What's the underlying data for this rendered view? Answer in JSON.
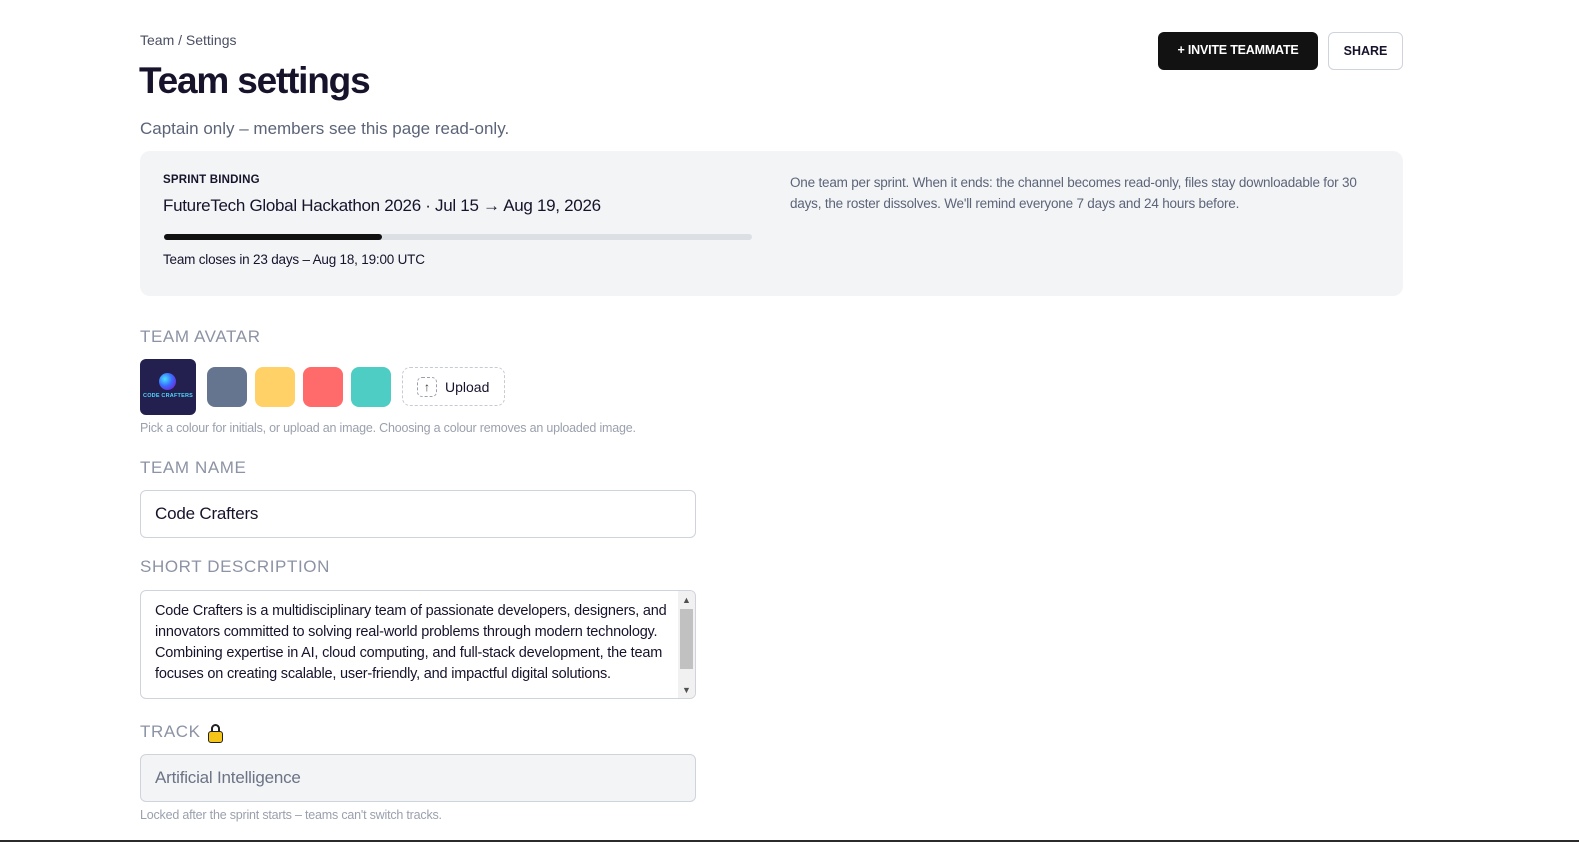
{
  "header": {
    "breadcrumb": "Team / Settings",
    "title": "Team settings",
    "subtitle": "Captain only – members see this page read-only.",
    "invite_label": "+ INVITE TEAMMATE",
    "share_label": "SHARE"
  },
  "sprint": {
    "label": "SPRINT BINDING",
    "event": "FutureTech Global Hackathon 2026 · Jul 15 → Aug 19, 2026",
    "progress_fraction": 0.37,
    "closes": "Team closes in 23 days – Aug 18, 19:00 UTC",
    "note": "One team per sprint. When it ends: the channel becomes read-only, files stay downloadable for 30 days, the roster dissolves. We'll remind everyone 7 days and 24 hours before."
  },
  "avatar": {
    "label": "TEAM AVATAR",
    "current_text": "CODE CRAFTERS",
    "swatches": [
      "#66758f",
      "#ffd166",
      "#ff6b6b",
      "#4ecdc4"
    ],
    "upload_label": "Upload",
    "upload_icon": "arrow-up-icon",
    "hint": "Pick a colour for initials, or upload an image. Choosing a colour removes an uploaded image."
  },
  "team_name": {
    "label": "TEAM NAME",
    "value": "Code Crafters"
  },
  "description": {
    "label": "SHORT DESCRIPTION",
    "value": "Code Crafters is a multidisciplinary team of passionate developers, designers, and innovators committed to solving real-world problems through modern technology. Combining expertise in AI, cloud computing, and full-stack development, the team focuses on creating scalable, user-friendly, and impactful digital solutions."
  },
  "track": {
    "label": "TRACK",
    "icon": "lock-icon",
    "value": "Artificial Intelligence",
    "hint": "Locked after the sprint starts – teams can't switch tracks."
  }
}
